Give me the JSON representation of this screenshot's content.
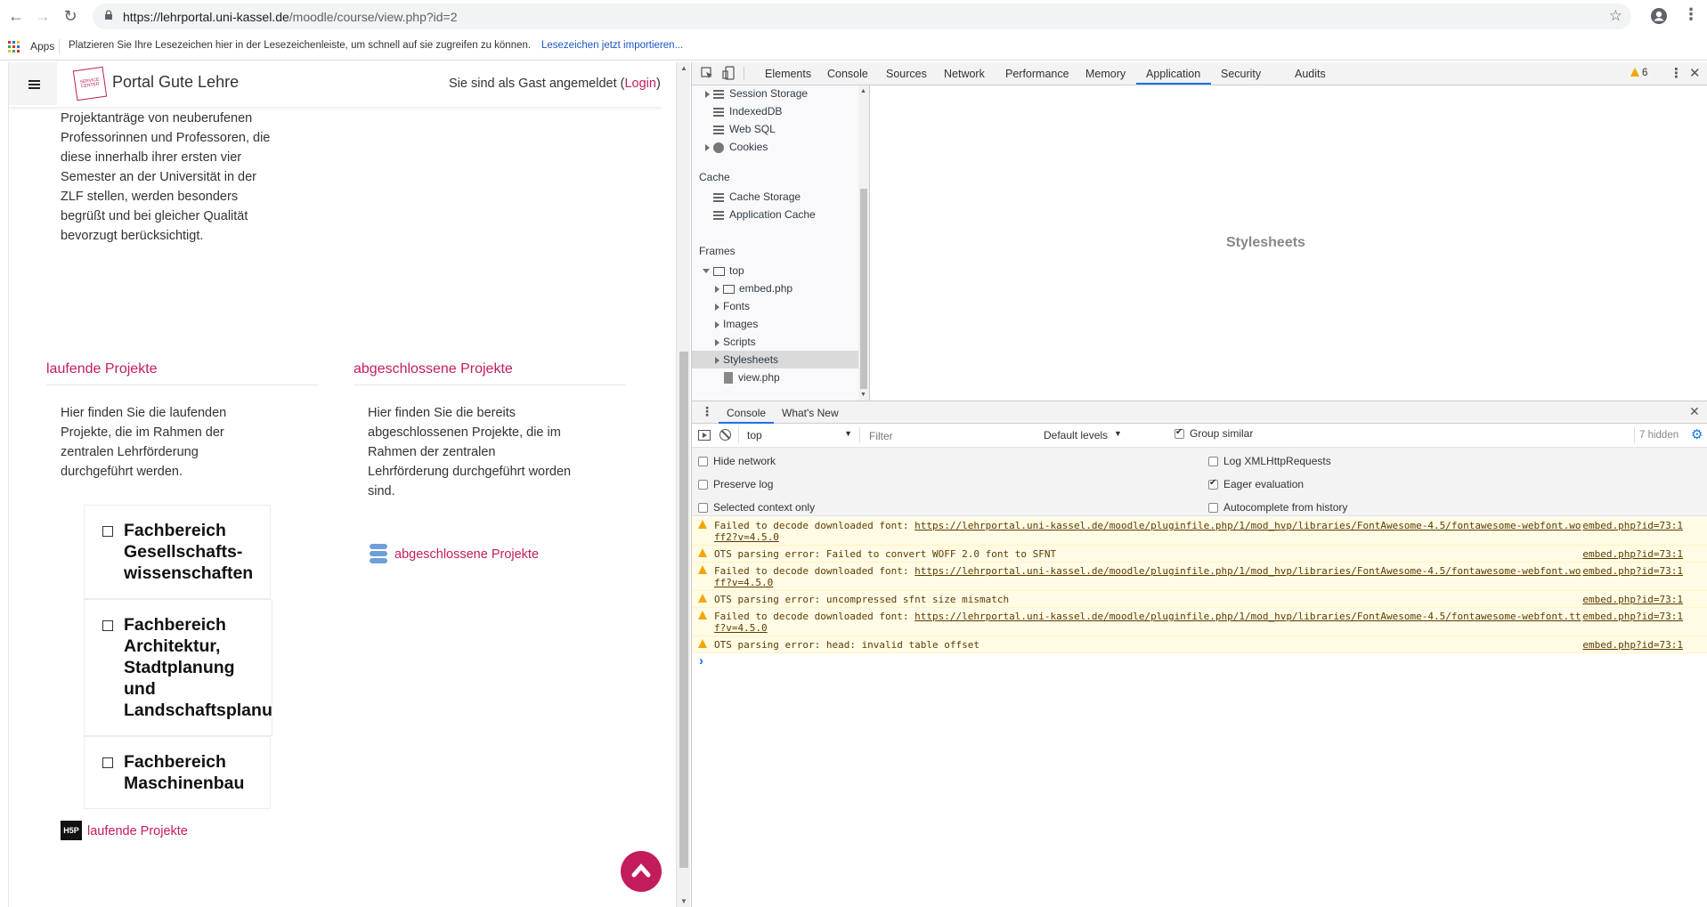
{
  "browser": {
    "url_domain": "https://lehrportal.uni-kassel.de",
    "url_path": "/moodle/course/view.php?id=2",
    "bookmarks": {
      "apps_label": "Apps",
      "hint": "Platzieren Sie Ihre Lesezeichen hier in der Lesezeichenleiste, um schnell auf sie zugreifen zu können.",
      "import_link": "Lesezeichen jetzt importieren..."
    }
  },
  "page": {
    "site_title": "Portal Gute Lehre",
    "logo_text": "SERVICE CENTER",
    "login_prefix": "Sie sind als Gast angemeldet (",
    "login_link": "Login",
    "login_suffix": ")",
    "intro_lines": [
      "Projektanträge von neuberufenen",
      "Professorinnen und Professoren, die",
      "diese innerhalb ihrer ersten vier",
      "Semester an der Universität in der",
      "ZLF stellen, werden besonders",
      "begrüßt und bei gleicher Qualität",
      "bevorzugt berücksichtigt."
    ],
    "section_running": {
      "title": "laufende Projekte",
      "desc_lines": [
        "Hier finden Sie die laufenden",
        "Projekte, die im Rahmen der",
        "zentralen Lehrförderung",
        "durchgeführt werden."
      ],
      "cards": [
        {
          "lines": [
            "Fachbereich",
            "Gesellschafts-",
            "wissenschaften"
          ]
        },
        {
          "lines": [
            "Fachbereich",
            "Architektur,",
            "Stadtplanung",
            "und",
            "Landschaftsplanu"
          ]
        },
        {
          "lines": [
            "Fachbereich",
            "Maschinenbau"
          ]
        }
      ],
      "h5p_badge": "H5P",
      "link": "laufende Projekte"
    },
    "section_finished": {
      "title": "abgeschlossene Projekte",
      "desc_lines": [
        "Hier finden Sie die bereits",
        "abgeschlossenen Projekte, die im",
        "Rahmen der zentralen",
        "Lehrförderung durchgeführt worden",
        "sind."
      ],
      "link": "abgeschlossene Projekte"
    }
  },
  "devtools": {
    "tabs": [
      "Elements",
      "Console",
      "Sources",
      "Network",
      "Performance",
      "Memory",
      "Application",
      "Security",
      "Audits"
    ],
    "active_tab": "Application",
    "warning_count": "6",
    "tree": {
      "storage_items": [
        "Session Storage",
        "IndexedDB",
        "Web SQL",
        "Cookies"
      ],
      "cache_header": "Cache",
      "cache_items": [
        "Cache Storage",
        "Application Cache"
      ],
      "frames_header": "Frames",
      "frame_top": "top",
      "frame_children": [
        "embed.php",
        "Fonts",
        "Images",
        "Scripts",
        "Stylesheets"
      ],
      "selected": "Stylesheets",
      "leaf": "view.php"
    },
    "main_placeholder": "Stylesheets",
    "drawer": {
      "tabs": [
        "Console",
        "What's New"
      ],
      "context": "top",
      "filter_placeholder": "Filter",
      "levels": "Default levels",
      "group_similar": "Group similar",
      "hidden_count": "7 hidden",
      "settings_left": [
        {
          "label": "Hide network",
          "checked": false
        },
        {
          "label": "Preserve log",
          "checked": false
        },
        {
          "label": "Selected context only",
          "checked": false
        }
      ],
      "settings_right": [
        {
          "label": "Log XMLHttpRequests",
          "checked": false
        },
        {
          "label": "Eager evaluation",
          "checked": true
        },
        {
          "label": "Autocomplete from history",
          "checked": false
        }
      ],
      "messages": [
        {
          "text": "Failed to decode downloaded font: ",
          "url": "https://lehrportal.uni-kassel.de/moodle/pluginfile.php/1/mod_hvp/libraries/FontAwesome-4.5/fontawesome-webfont.wo",
          "url2": "ff2?v=4.5.0",
          "source": "embed.php?id=73:1"
        },
        {
          "text": "OTS parsing error: Failed to convert WOFF 2.0 font to SFNT",
          "url": "",
          "url2": "",
          "source": "embed.php?id=73:1"
        },
        {
          "text": "Failed to decode downloaded font: ",
          "url": "https://lehrportal.uni-kassel.de/moodle/pluginfile.php/1/mod_hvp/libraries/FontAwesome-4.5/fontawesome-webfont.wo",
          "url2": "ff?v=4.5.0",
          "source": "embed.php?id=73:1"
        },
        {
          "text": "OTS parsing error: uncompressed sfnt size mismatch",
          "url": "",
          "url2": "",
          "source": "embed.php?id=73:1"
        },
        {
          "text": "Failed to decode downloaded font: ",
          "url": "https://lehrportal.uni-kassel.de/moodle/pluginfile.php/1/mod_hvp/libraries/FontAwesome-4.5/fontawesome-webfont.tt",
          "url2": "f?v=4.5.0",
          "source": "embed.php?id=73:1"
        },
        {
          "text": "OTS parsing error: head: invalid table offset",
          "url": "",
          "url2": "",
          "source": "embed.php?id=73:1"
        }
      ],
      "prompt": "›"
    }
  },
  "colors": {
    "accent": "#c31c5d",
    "devtools_active": "#1a73e8",
    "warning_bg": "#fffbe5"
  }
}
